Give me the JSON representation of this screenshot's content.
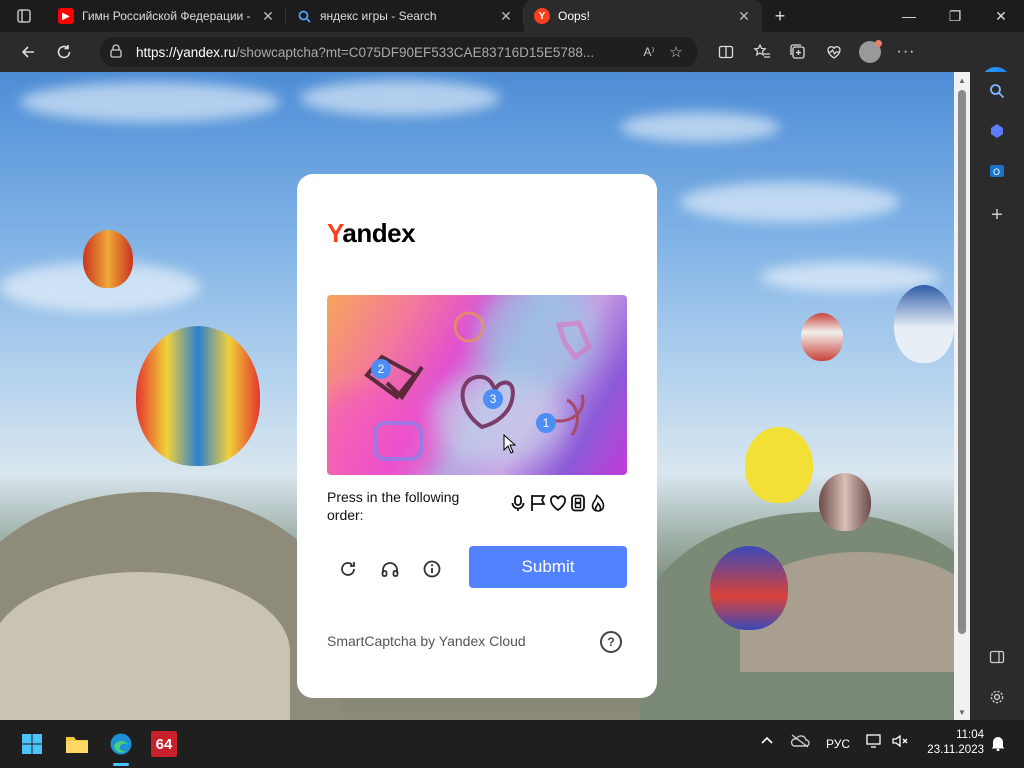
{
  "browser": {
    "tabs": [
      {
        "title": "Гимн Российской Федерации -",
        "favicon": "youtube-icon",
        "favicon_color": "#ff0000"
      },
      {
        "title": "яндекс игры - Search",
        "favicon": "bing-search-icon",
        "favicon_color": "#4aa3ff"
      },
      {
        "title": "Oops!",
        "favicon": "yandex-icon",
        "favicon_color": "#fc3f1d"
      }
    ],
    "url_host": "https://yandex.ru",
    "url_path": "/showcaptcha?mt=C075DF90EF533CAE83716D15E5788...",
    "read_aloud": "A⁾"
  },
  "captcha": {
    "logo_first": "Y",
    "logo_rest": "andex",
    "instruction": "Press in the following order:",
    "order_icons": [
      "microphone-icon",
      "flag-icon",
      "heart-icon",
      "film-strip-icon",
      "flame-icon"
    ],
    "markers": [
      "2",
      "3",
      "1"
    ],
    "submit_label": "Submit",
    "footer": "SmartCaptcha by Yandex Cloud",
    "help": "?",
    "accent": "#5282ff"
  },
  "taskbar": {
    "language": "РУС",
    "time": "11:04",
    "date": "23.11.2023",
    "app_badge": "64"
  }
}
